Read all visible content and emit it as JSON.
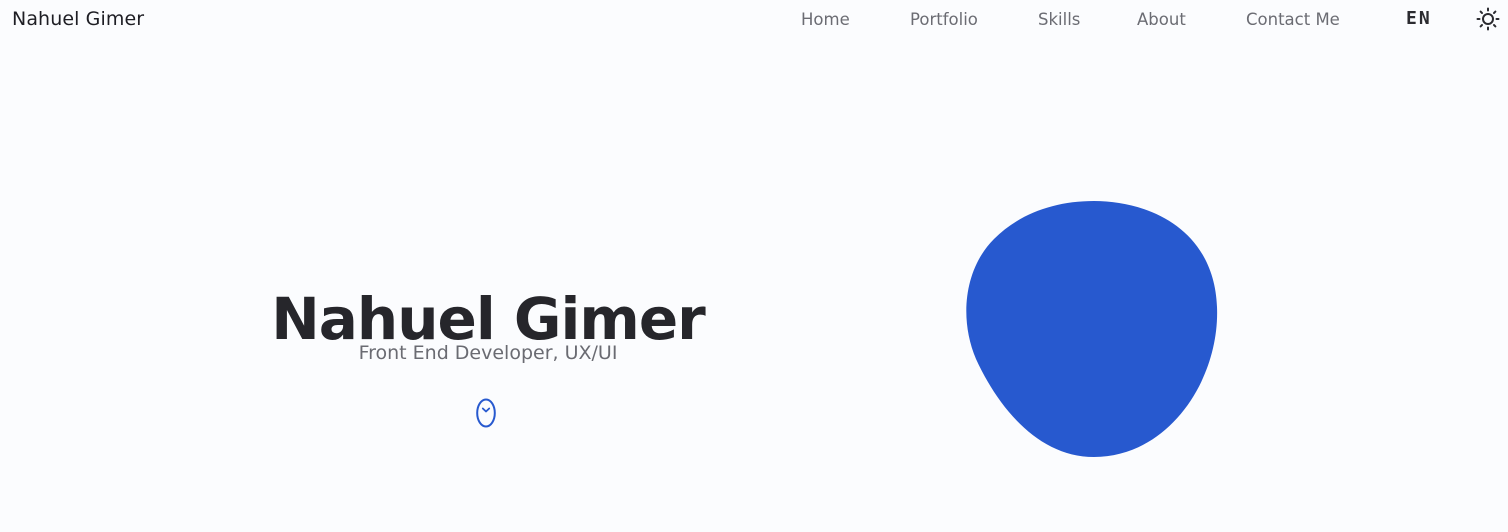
{
  "header": {
    "brand": "Nahuel Gimer",
    "nav": [
      {
        "label": "Home"
      },
      {
        "label": "Portfolio"
      },
      {
        "label": "Skills"
      },
      {
        "label": "About"
      },
      {
        "label": "Contact Me"
      }
    ],
    "language": "EN",
    "theme_icon": "sun-icon"
  },
  "hero": {
    "name": "Nahuel Gimer",
    "subtitle": "Front End Developer, UX/UI",
    "scroll_icon": "mouse-scroll-icon",
    "accent_color": "#2759cf"
  }
}
